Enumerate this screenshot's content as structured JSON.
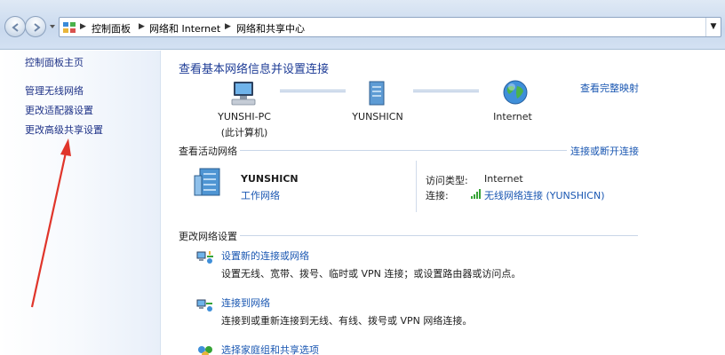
{
  "breadcrumb": {
    "items": [
      "控制面板",
      "网络和 Internet",
      "网络和共享中心"
    ]
  },
  "left_pane": {
    "links": [
      "控制面板主页",
      "管理无线网络",
      "更改适配器设置",
      "更改高级共享设置"
    ]
  },
  "main": {
    "title": "查看基本网络信息并设置连接",
    "full_map_link": "查看完整映射",
    "map": {
      "computer_name": "YUNSHI-PC",
      "computer_note": "(此计算机)",
      "network_name": "YUNSHICN",
      "internet_label": "Internet"
    },
    "active_networks": {
      "heading": "查看活动网络",
      "connect_link": "连接或断开连接",
      "network_name": "YUNSHICN",
      "network_type": "工作网络",
      "access_type_key": "访问类型:",
      "access_type_value": "Internet",
      "connection_key": "连接:",
      "connection_value": "无线网络连接 (YUNSHICN)"
    },
    "change_settings": {
      "heading": "更改网络设置",
      "tasks": [
        {
          "label": "设置新的连接或网络",
          "desc": "设置无线、宽带、拨号、临时或 VPN 连接；或设置路由器或访问点。",
          "icon": "setup-connection-icon"
        },
        {
          "label": "连接到网络",
          "desc": "连接到或重新连接到无线、有线、拨号或 VPN 网络连接。",
          "icon": "connect-network-icon"
        },
        {
          "label": "选择家庭组和共享选项",
          "desc": "",
          "icon": "homegroup-icon"
        }
      ]
    }
  },
  "annotation": {
    "arrow_color": "#e0352b"
  }
}
